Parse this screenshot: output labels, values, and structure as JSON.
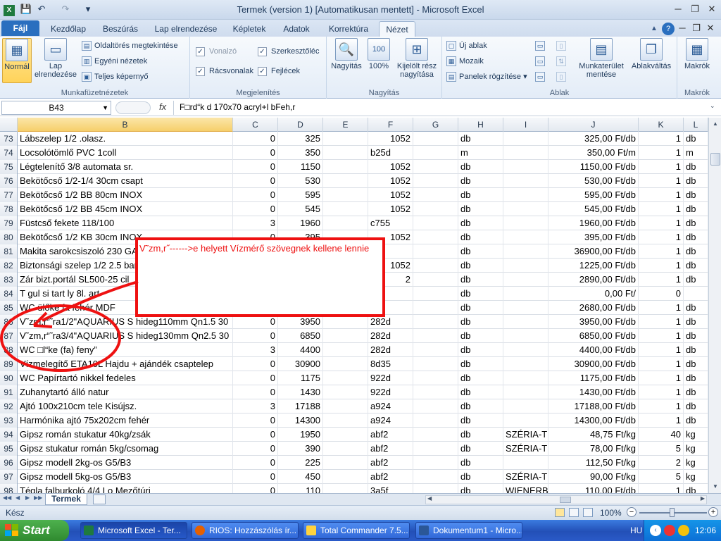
{
  "window": {
    "title": "Termek (version 1) [Automatikusan mentett]  -  Microsoft Excel",
    "minimize": "─",
    "restore": "❐",
    "close": "✕"
  },
  "quick_access": {
    "save": "💾",
    "undo": "↶",
    "redo": "↷",
    "more": "▾"
  },
  "tabs": [
    "Fájl",
    "Kezdőlap",
    "Beszúrás",
    "Lap elrendezése",
    "Képletek",
    "Adatok",
    "Korrektúra",
    "Nézet"
  ],
  "ribbon": {
    "workbook_views": {
      "label": "Munkafüzetnézetek",
      "normal": "Normál",
      "page_layout": "Lap elrendezése",
      "page_break": "Oldaltörés megtekintése",
      "custom": "Egyéni nézetek",
      "full": "Teljes képernyő"
    },
    "show": {
      "label": "Megjelenítés",
      "ruler": "Vonalzó",
      "gridlines": "Rácsvonalak",
      "formula_bar": "Szerkesztőléc",
      "headings": "Fejlécek"
    },
    "zoom": {
      "label": "Nagyítás",
      "zoom": "Nagyítás",
      "hundred": "100%",
      "selection": "Kijelölt rész nagyítása"
    },
    "window": {
      "label": "Ablak",
      "new": "Új ablak",
      "arrange": "Mozaik",
      "freeze": "Panelek rögzítése",
      "save_ws": "Munkaterület mentése",
      "switch": "Ablakváltás"
    },
    "macros": {
      "label": "Makrók",
      "macros": "Makrók"
    }
  },
  "formula_bar": {
    "name_box": "B43",
    "fx": "fx",
    "content": "F□rd“k d 170x70 acryl+l bFeh,r"
  },
  "columns": [
    "B",
    "C",
    "D",
    "E",
    "F",
    "G",
    "H",
    "I",
    "J",
    "K",
    "L"
  ],
  "rows": [
    {
      "n": "73",
      "b": "Lábszelep 1/2 .olasz.",
      "c": "0",
      "d": "325",
      "e": "",
      "f": "1052",
      "h": "db",
      "i": "",
      "j": "325,00 Ft/db",
      "k": "1",
      "l": "db"
    },
    {
      "n": "74",
      "b": "Locsolótömlő PVC 1coll",
      "c": "0",
      "d": "350",
      "e": "",
      "f": "b25d",
      "h": "m",
      "i": "",
      "j": "350,00 Ft/m",
      "k": "1",
      "l": "m"
    },
    {
      "n": "75",
      "b": "Légtelenítő 3/8 automata sr.",
      "c": "0",
      "d": "1150",
      "e": "",
      "f": "1052",
      "h": "db",
      "i": "",
      "j": "1150,00 Ft/db",
      "k": "1",
      "l": "db"
    },
    {
      "n": "76",
      "b": "Bekötőcső 1/2-1/4 30cm csapt",
      "c": "0",
      "d": "530",
      "e": "",
      "f": "1052",
      "h": "db",
      "i": "",
      "j": "530,00 Ft/db",
      "k": "1",
      "l": "db"
    },
    {
      "n": "77",
      "b": "Bekötőcső 1/2 BB 80cm INOX",
      "c": "0",
      "d": "595",
      "e": "",
      "f": "1052",
      "h": "db",
      "i": "",
      "j": "595,00 Ft/db",
      "k": "1",
      "l": "db"
    },
    {
      "n": "78",
      "b": "Bekötőcső 1/2 BB 45cm INOX",
      "c": "0",
      "d": "545",
      "e": "",
      "f": "1052",
      "h": "db",
      "i": "",
      "j": "545,00 Ft/db",
      "k": "1",
      "l": "db"
    },
    {
      "n": "79",
      "b": "Füstcső fekete 118/100",
      "c": "3",
      "d": "1960",
      "e": "",
      "f": "c755",
      "h": "db",
      "i": "",
      "j": "1960,00 Ft/db",
      "k": "1",
      "l": "db"
    },
    {
      "n": "80",
      "b": "Bekötőcső 1/2 KB 30cm  INOX",
      "c": "0",
      "d": "395",
      "e": "",
      "f": "1052",
      "h": "db",
      "i": "",
      "j": "395,00 Ft/db",
      "k": "1",
      "l": "db"
    },
    {
      "n": "81",
      "b": "Makita sarokcsiszoló 230 GA",
      "c": "0",
      "d": "36900",
      "e": "",
      "f": "c",
      "h": "db",
      "i": "",
      "j": "36900,00 Ft/db",
      "k": "1",
      "l": "db"
    },
    {
      "n": "82",
      "b": "Biztonsági szelep 1/2 2.5 bar",
      "c": "0",
      "d": "1225",
      "e": "",
      "f": "1052",
      "h": "db",
      "i": "",
      "j": "1225,00 Ft/db",
      "k": "1",
      "l": "db"
    },
    {
      "n": "83",
      "b": "Zár bizt.portál SL500-25 cil",
      "c": "0",
      "d": "2890",
      "e": "",
      "f": "2",
      "h": "db",
      "i": "",
      "j": "2890,00 Ft/db",
      "k": "1",
      "l": "db"
    },
    {
      "n": "84",
      "b": "T gul si tart ly 8l. art",
      "c": "0",
      "d": "0",
      "e": "",
      "f": "d",
      "h": "db",
      "i": "",
      "j": "0,00 Ft/",
      "k": "0",
      "l": ""
    },
    {
      "n": "85",
      "b": "WC ülőke fa fehér MDF",
      "c": "0",
      "d": "2680",
      "e": "",
      "f": "d",
      "h": "db",
      "i": "",
      "j": "2680,00 Ft/db",
      "k": "1",
      "l": "db"
    },
    {
      "n": "86",
      "b": "V˜zm,r“˜ra1/2\"AQUARIUS S hideg110mm Qn1.5 30",
      "c": "0",
      "d": "3950",
      "e": "",
      "f": "282d",
      "h": "db",
      "i": "",
      "j": "3950,00 Ft/db",
      "k": "1",
      "l": "db"
    },
    {
      "n": "87",
      "b": "V˜zm,r“˜ra3/4\"AQUARIUS S hideg130mm Qn2.5 30",
      "c": "0",
      "d": "6850",
      "e": "",
      "f": "282d",
      "h": "db",
      "i": "",
      "j": "6850,00 Ft/db",
      "k": "1",
      "l": "db"
    },
    {
      "n": "88",
      "b": "WC □l“ke (fa) feny”",
      "c": "3",
      "d": "4400",
      "e": "",
      "f": "282d",
      "h": "db",
      "i": "",
      "j": "4400,00 Ft/db",
      "k": "1",
      "l": "db"
    },
    {
      "n": "89",
      "b": "Vízmelegítő ETA10L Hajdu + ajándék csaptelep",
      "c": "0",
      "d": "30900",
      "e": "",
      "f": "8d35",
      "h": "db",
      "i": "",
      "j": "30900,00 Ft/db",
      "k": "1",
      "l": "db"
    },
    {
      "n": "90",
      "b": "WC Papírtartó nikkel fedeles",
      "c": "0",
      "d": "1175",
      "e": "",
      "f": "922d",
      "h": "db",
      "i": "",
      "j": "1175,00 Ft/db",
      "k": "1",
      "l": "db"
    },
    {
      "n": "91",
      "b": "Zuhanytartó álló natur",
      "c": "0",
      "d": "1430",
      "e": "",
      "f": "922d",
      "h": "db",
      "i": "",
      "j": "1430,00 Ft/db",
      "k": "1",
      "l": "db"
    },
    {
      "n": "92",
      "b": "Ajtó 100x210cm tele   Kisújsz.",
      "c": "3",
      "d": "17188",
      "e": "",
      "f": "a924",
      "h": "db",
      "i": "",
      "j": "17188,00 Ft/db",
      "k": "1",
      "l": "db"
    },
    {
      "n": "93",
      "b": "Harmónika ajtó 75x202cm fehér",
      "c": "0",
      "d": "14300",
      "e": "",
      "f": "a924",
      "h": "db",
      "i": "",
      "j": "14300,00 Ft/db",
      "k": "1",
      "l": "db"
    },
    {
      "n": "94",
      "b": "Gipsz román stukatur 40kg/zsák",
      "c": "0",
      "d": "1950",
      "e": "",
      "f": "abf2",
      "h": "db",
      "i": "SZÉRIA-TR",
      "j": "48,75 Ft/kg",
      "k": "40",
      "l": "kg"
    },
    {
      "n": "95",
      "b": "Gipsz stukatur román 5kg/csomag",
      "c": "0",
      "d": "390",
      "e": "",
      "f": "abf2",
      "h": "db",
      "i": "SZÉRIA-TR",
      "j": "78,00 Ft/kg",
      "k": "5",
      "l": "kg"
    },
    {
      "n": "96",
      "b": "Gipsz modell 2kg-os G5/B3",
      "c": "0",
      "d": "225",
      "e": "",
      "f": "abf2",
      "h": "db",
      "i": "",
      "j": "112,50 Ft/kg",
      "k": "2",
      "l": "kg"
    },
    {
      "n": "97",
      "b": "Gipsz modell 5kg-os G5/B3",
      "c": "0",
      "d": "450",
      "e": "",
      "f": "abf2",
      "h": "db",
      "i": "SZÉRIA-TR",
      "j": "90,00 Ft/kg",
      "k": "5",
      "l": "kg"
    },
    {
      "n": "98",
      "b": "Tégla falburkoló 4/4 Lo Mezőtúri",
      "c": "0",
      "d": "110",
      "e": "",
      "f": "3a5f",
      "h": "db",
      "i": "WIENERBE",
      "j": "110,00 Ft/db",
      "k": "1",
      "l": "db"
    }
  ],
  "callout": {
    "text": "V˜zm,r˝------>e helyett Vízmérő szövegnek kellene lennie"
  },
  "sheet": {
    "name": "Termek"
  },
  "status": {
    "ready": "Kész",
    "zoom": "100%",
    "minus": "−",
    "plus": "+"
  },
  "taskbar": {
    "start": "Start",
    "items": [
      "Microsoft Excel - Ter...",
      "RIOS: Hozzászólás ír...",
      "Total Commander 7.5...",
      "Dokumentum1 - Micro..."
    ],
    "lang": "HU",
    "clock": "12:06"
  }
}
